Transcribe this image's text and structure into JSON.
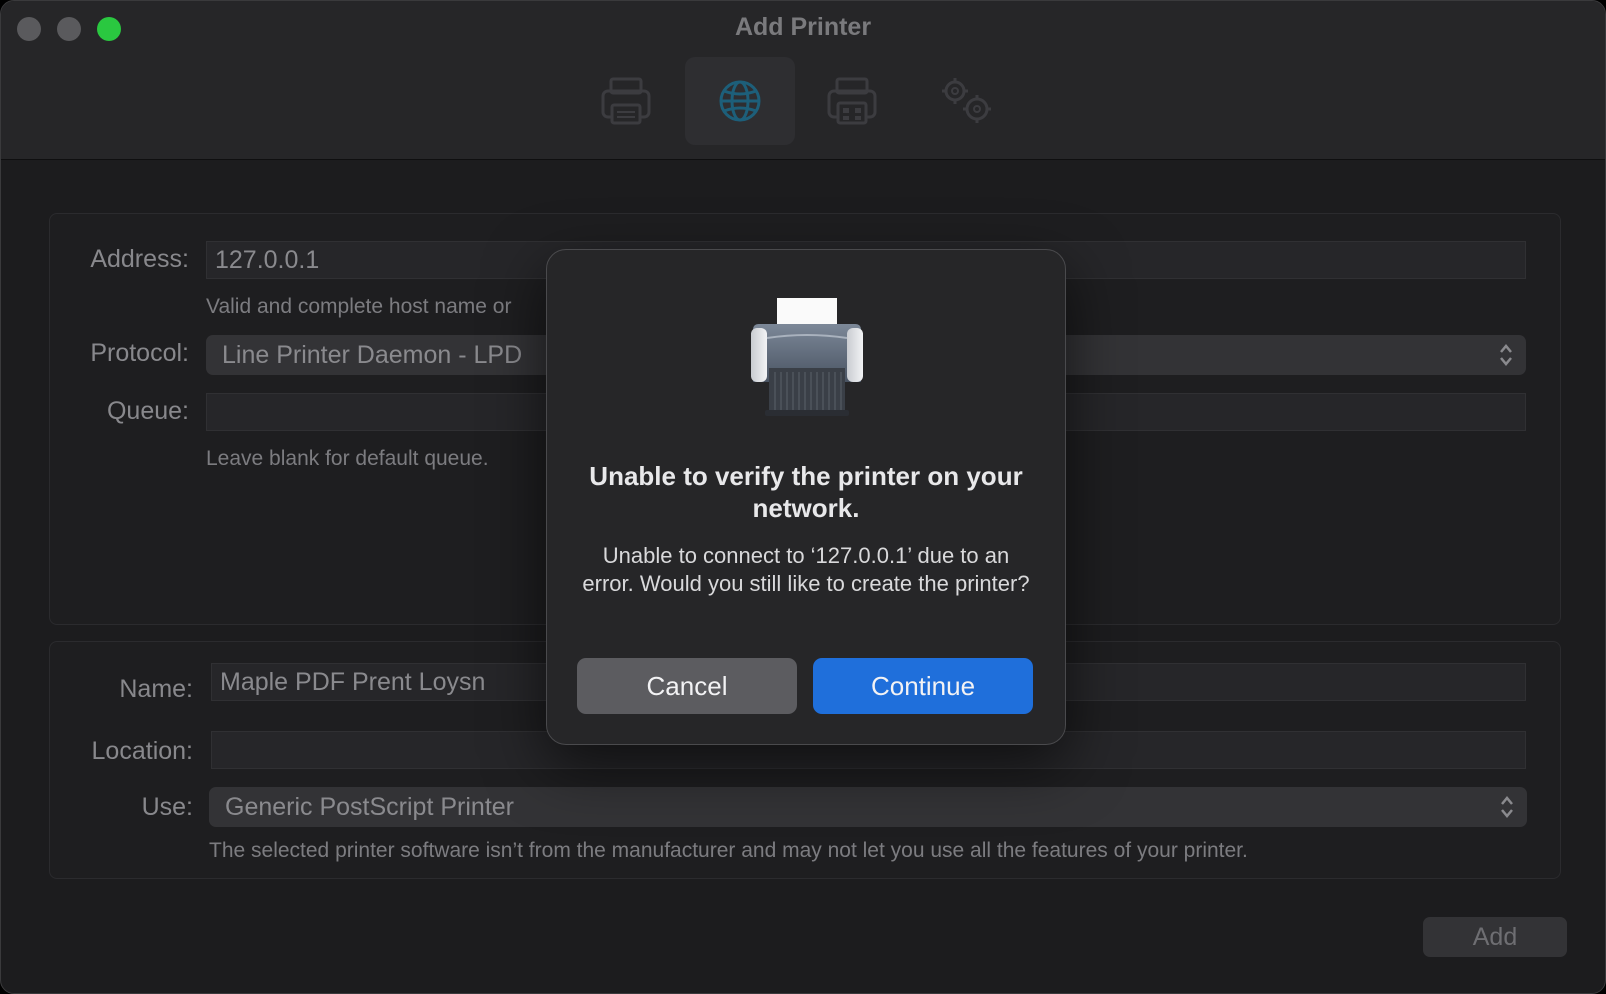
{
  "window": {
    "title": "Add Printer"
  },
  "toolbar": {
    "items": [
      {
        "name": "default",
        "icon": "printer-icon"
      },
      {
        "name": "ip",
        "icon": "globe-icon",
        "selected": true
      },
      {
        "name": "windows",
        "icon": "printer-grid-icon"
      },
      {
        "name": "advanced",
        "icon": "gears-icon"
      }
    ]
  },
  "form": {
    "address_label": "Address:",
    "address_value": "127.0.0.1",
    "address_hint": "Valid and complete host name or",
    "protocol_label": "Protocol:",
    "protocol_value": "Line Printer Daemon - LPD",
    "queue_label": "Queue:",
    "queue_value": "",
    "queue_hint": "Leave blank for default queue.",
    "name_label": "Name:",
    "name_value": "Maple PDF Prent Loysn",
    "location_label": "Location:",
    "location_value": "",
    "use_label": "Use:",
    "use_value": "Generic PostScript Printer",
    "use_hint": "The selected printer software isn’t from the manufacturer and may not let you use all the features of your printer.",
    "add_label": "Add"
  },
  "dialog": {
    "title": "Unable to verify the printer on your network.",
    "message": "Unable to connect to ‘127.0.0.1’ due to an error. Would you still like to create the printer?",
    "cancel_label": "Cancel",
    "continue_label": "Continue"
  },
  "colors": {
    "accent": "#1f6fdb",
    "zoom": "#2ac840"
  }
}
